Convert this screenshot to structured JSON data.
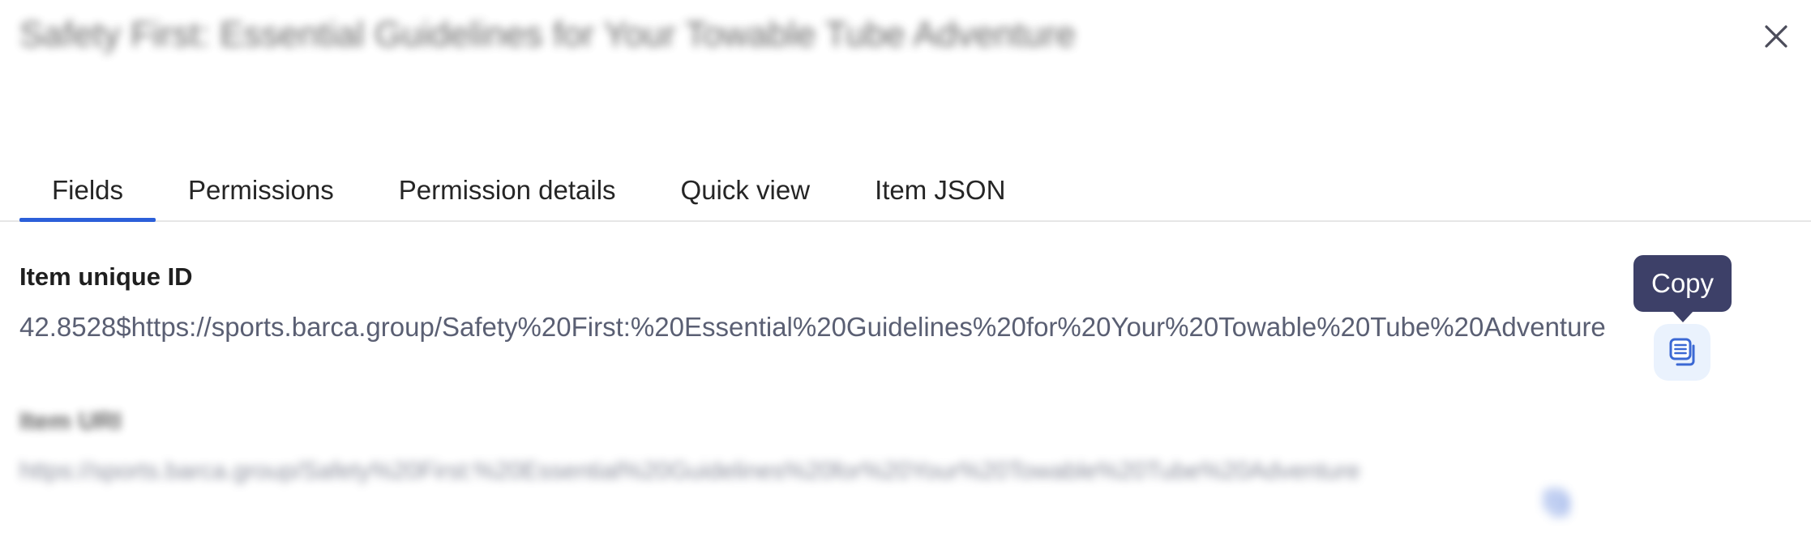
{
  "header": {
    "title": "Safety First: Essential Guidelines for Your Towable Tube Adventure",
    "close_label": "Close"
  },
  "tabs": [
    {
      "label": "Fields",
      "active": true
    },
    {
      "label": "Permissions",
      "active": false
    },
    {
      "label": "Permission details",
      "active": false
    },
    {
      "label": "Quick view",
      "active": false
    },
    {
      "label": "Item JSON",
      "active": false
    }
  ],
  "fields": [
    {
      "label": "Item unique ID",
      "value": "42.8528$https://sports.barca.group/Safety%20First:%20Essential%20Guidelines%20for%20Your%20Towable%20Tube%20Adventure",
      "copy_label": "Copy"
    },
    {
      "label": "Item URI",
      "value": "https://sports.barca.group/Safety%20First:%20Essential%20Guidelines%20for%20Your%20Towable%20Tube%20Adventure",
      "copy_label": "Copy"
    }
  ],
  "tooltip": {
    "text": "Copy"
  },
  "colors": {
    "accent": "#2b5fd9",
    "copy_icon": "#3b68d4",
    "copy_hover_bg": "#eaf2fd",
    "tooltip_bg": "#3d4068",
    "heading": "#1f1f1f",
    "value_text": "#5a5f73",
    "divider": "#e6e6e6"
  }
}
